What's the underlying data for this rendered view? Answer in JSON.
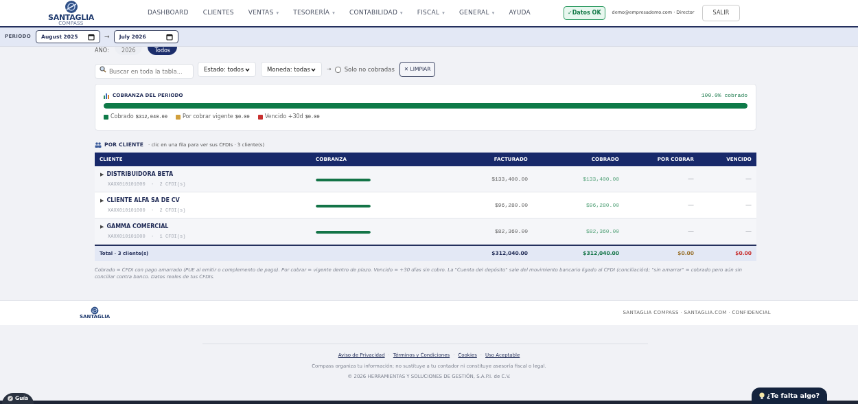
{
  "header": {
    "logo_text": "SANTAGLIA",
    "logo_sub": "COMPASS",
    "nav": [
      {
        "label": "DASHBOARD",
        "dropdown": false
      },
      {
        "label": "CLIENTES",
        "dropdown": false
      },
      {
        "label": "VENTAS",
        "dropdown": true
      },
      {
        "label": "TESORERÍA",
        "dropdown": true
      },
      {
        "label": "CONTABILIDAD",
        "dropdown": true
      },
      {
        "label": "FISCAL",
        "dropdown": true
      },
      {
        "label": "GENERAL",
        "dropdown": true
      },
      {
        "label": "AYUDA",
        "dropdown": false
      }
    ],
    "caret": "▾",
    "status_badge": "✓Datos OK",
    "user": "demo@empresademo.com · Director",
    "logout": "SALIR"
  },
  "period": {
    "label": "PERIODO",
    "from": "August 2025",
    "arrow": "→",
    "to": "July 2026"
  },
  "year_filter": {
    "label": "ANO:",
    "options": [
      {
        "label": "2026",
        "selected": false
      },
      {
        "label": "Todos",
        "selected": true
      }
    ]
  },
  "filters": {
    "search_placeholder": "Buscar en toda la tabla...",
    "estado": "Estado: todos",
    "moneda": "Moneda: todas",
    "arrow": "→",
    "only_unpaid": {
      "label": "Solo no cobradas",
      "checked": false
    },
    "clear": "✕ LIMPIAR"
  },
  "summary": {
    "title": "COBRANZA DEL PERIODO",
    "percent": "100.0% cobrado",
    "level": 1.0,
    "legend": [
      {
        "label": "Cobrado",
        "value": "$312,040.00",
        "color": "#0e7a48"
      },
      {
        "label": "Por cobrar vigente",
        "value": "$0.00",
        "color": "#d19f3c"
      },
      {
        "label": "Vencido +30d",
        "value": "$0.00",
        "color": "#c8302f"
      }
    ]
  },
  "by_client": {
    "title": "POR CLIENTE",
    "hint": "· clic en una fila para ver sus CFDIs · 3 cliente(s)",
    "columns": [
      "CLIENTE",
      "COBRANZA",
      "FACTURADO",
      "COBRADO",
      "POR COBRAR",
      "VENCIDO"
    ],
    "expand_glyph": "▶",
    "rows": [
      {
        "name": "DISTRIBUIDORA BETA",
        "meta": "XAXX010101000  ·  2 CFDI(s)",
        "level": 1.0,
        "facturado": "$133,400.00",
        "cobrado": "$133,400.00",
        "por_cobrar": "—",
        "vencido": "—"
      },
      {
        "name": "CLIENTE ALFA SA DE CV",
        "meta": "XAXX010101000  ·  2 CFDI(s)",
        "level": 1.0,
        "facturado": "$96,280.00",
        "cobrado": "$96,280.00",
        "por_cobrar": "—",
        "vencido": "—"
      },
      {
        "name": "GAMMA COMERCIAL",
        "meta": "XAXX010101000  ·  1 CFDI(s)",
        "level": 1.0,
        "facturado": "$82,360.00",
        "cobrado": "$82,360.00",
        "por_cobrar": "—",
        "vencido": "—"
      }
    ],
    "total": {
      "label": "Total · 3 cliente(s)",
      "facturado": "$312,040.00",
      "cobrado": "$312,040.00",
      "por_cobrar": "$0.00",
      "vencido": "$0.00"
    },
    "note": "Cobrado = CFDI con pago amarrado (PUE al emitir o complemento de pago). Por cobrar = vigente dentro de plazo. Vencido = +30 días sin cobro. La \"Cuenta del depósito\" sale del movimiento bancario ligado al CFDI (conciliación); \"sin amarrar\" = cobrado pero aún sin conciliar contra banco. Datos reales de tus CFDIs."
  },
  "footer": {
    "logo_text": "SANTAGLIA",
    "tagline": "SANTAGLIA COMPASS · SANTAGLIA.COM · CONFIDENCIAL",
    "links": [
      "Aviso de Privacidad",
      "Términos y Condiciones",
      "Cookies",
      "Uso Aceptable"
    ],
    "separator": "·",
    "disclaimer": "Compass organiza tu información; no sustituye a tu contador ni constituye asesoría fiscal o legal.",
    "copyright": "© 2026 HERRAMIENTAS Y SOLUCIONES DE GESTIÓN, S.A.P.I. de C.V."
  },
  "guide_button": "Guía",
  "feedback_button": "¿Te falta algo?"
}
